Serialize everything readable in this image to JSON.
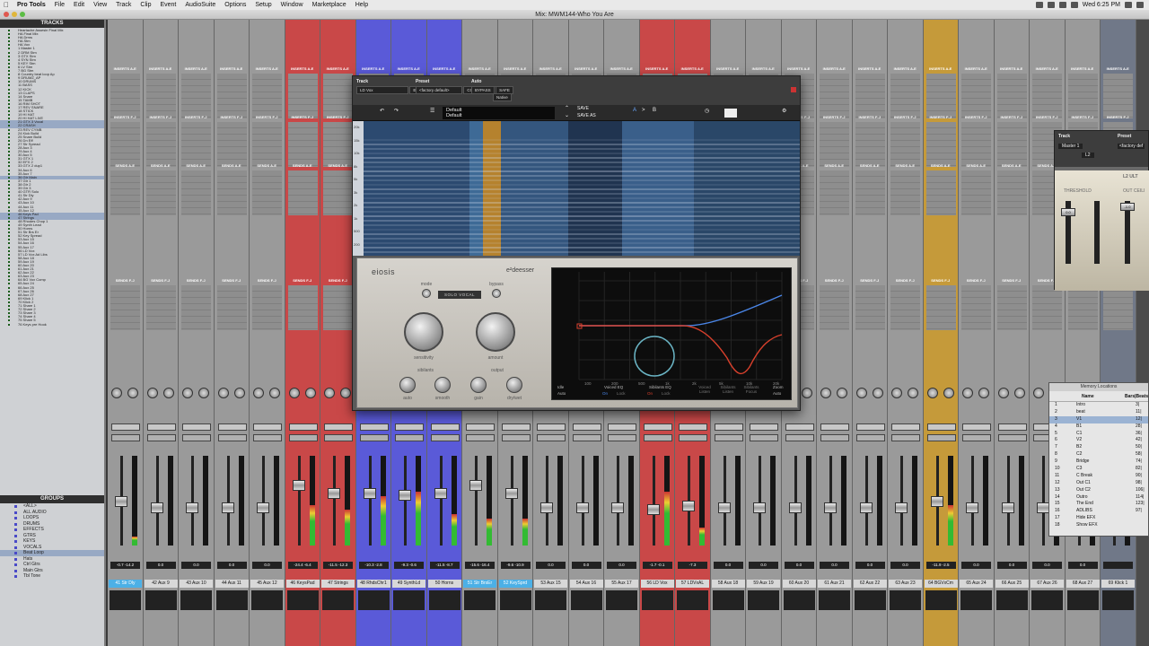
{
  "menubar": {
    "app": "Pro Tools",
    "menus": [
      "File",
      "Edit",
      "View",
      "Track",
      "Clip",
      "Event",
      "AudioSuite",
      "Options",
      "Setup",
      "Window",
      "Marketplace",
      "Help"
    ],
    "clock": "Wed 6:25 PM"
  },
  "window": {
    "title": "Mix: MWM144-Who You Are"
  },
  "tracks_panel": {
    "title": "TRACKS",
    "items": [
      "Heartache Assesin Final Mix",
      "HA Final Mix",
      "HA Drms",
      "HA Stm",
      "HA Vox",
      "1 Master 1",
      "2 DRM Stm",
      "3 GTX Stm",
      "4 SYN Stm",
      "5 KEY Stm",
      "6 LV Stm",
      "7 BG Stm",
      "8 Country beat loop Ap",
      "9 DRUMZ_AP",
      "10 DRUMS",
      "11 BASS",
      "12 KICK",
      "13 CLAPS",
      "14 Snare",
      "15 TAMB",
      "16 RIM SHOT",
      "17 REV SNARE",
      "18 STICK",
      "19 HI HAT",
      "20 HI HAT LIVE",
      "21 GTX 3 Vocal",
      "22 CRASH",
      "23 REV CYMB",
      "24 Kick Build",
      "25 Snare Build",
      "26 Dn Eff",
      "27 Str Spread",
      "28 Aux 3",
      "29 Aux 4",
      "30 Aux 5",
      "31 GTX 1",
      "32 EFX 2",
      "33 GTX 2 dup1",
      "34 Aux 6",
      "35 Aux 7",
      "36 Gtr Main",
      "37 Gtr 1",
      "38 Gtr 2",
      "39 Gtr 3",
      "40 GTR Solo",
      "41 Str Dly",
      "42 Aux 9",
      "43 Aux 10",
      "44 Aux 11",
      "45 Aux 12",
      "46 Keys Pad",
      "47 Strings",
      "48 Rhodes Chop 1",
      "49 Synth Lead",
      "50 Horns",
      "51 Str Brs Er",
      "52 Key Spread",
      "53 Aux 15",
      "54 Aux 16",
      "55 Aux 17",
      "56 LD Vox",
      "57 LD Vox Ad Libs",
      "58 Aux 18",
      "59 Aux 19",
      "60 Aux 20",
      "61 Aux 21",
      "62 Aux 22",
      "63 Aux 23",
      "64 BG Vox Comp",
      "65 Aux 24",
      "66 Aux 25",
      "67 Aux 26",
      "68 Aux 27",
      "69 Klick 1",
      "70 Klick 2",
      "71 Share 1",
      "72 Share 2",
      "73 Share 3",
      "74 Share 4",
      "75 Share 5",
      "76 Keys pre Hook"
    ]
  },
  "groups_panel": {
    "title": "GROUPS",
    "items": [
      "<ALL>",
      "ALL AUDIO",
      "LOOPS",
      "DRUMS",
      "EFFECTS",
      "GTRS",
      "KEYS",
      "VOCALS",
      "Beat Loop",
      "Hats",
      "Ctrl Gtrs",
      "Main Gtrs",
      "Tbl Tone"
    ]
  },
  "mixer": {
    "inserts_label": "INSERTS A-E",
    "inserts_label2": "INSERTS F-J",
    "sends_label": "SENDS A-E",
    "sends_label2": "SENDS F-J",
    "strips": [
      {
        "name": "41 Str Dly",
        "color": "#9a9a9a",
        "vol": "-0.7  -14.2",
        "fader": 0.5,
        "meter": 0.1,
        "hl": true
      },
      {
        "name": "42 Aux 9",
        "color": "#9a9a9a",
        "vol": "0.0",
        "fader": 0.42,
        "meter": 0.0
      },
      {
        "name": "43 Aux 10",
        "color": "#9a9a9a",
        "vol": "0.0",
        "fader": 0.42,
        "meter": 0.0
      },
      {
        "name": "44 Aux 11",
        "color": "#9a9a9a",
        "vol": "0.0",
        "fader": 0.42,
        "meter": 0.0
      },
      {
        "name": "45 Aux 12",
        "color": "#9a9a9a",
        "vol": "0.0",
        "fader": 0.42,
        "meter": 0.0
      },
      {
        "name": "46 KeysPad",
        "color": "#c94848",
        "vol": "-24.4  -6.4",
        "fader": 0.7,
        "meter": 0.45
      },
      {
        "name": "47 Strings",
        "color": "#c94848",
        "vol": "-11.5  -12.3",
        "fader": 0.6,
        "meter": 0.4
      },
      {
        "name": "48 RhdsChr1",
        "color": "#5a5ad8",
        "vol": "-10.3  -2.8",
        "fader": 0.6,
        "meter": 0.55
      },
      {
        "name": "49 SynthLd",
        "color": "#5a5ad8",
        "vol": "-9.3  -0.6",
        "fader": 0.58,
        "meter": 0.6
      },
      {
        "name": "50 Horns",
        "color": "#5a5ad8",
        "vol": "-11.5  -8.7",
        "fader": 0.6,
        "meter": 0.35
      },
      {
        "name": "51 Str BrsEr",
        "color": "#9a9a9a",
        "vol": "-15.6  -16.4",
        "fader": 0.7,
        "meter": 0.3,
        "hl": true
      },
      {
        "name": "52 KeySprd",
        "color": "#9a9a9a",
        "vol": "-9.6  -10.9",
        "fader": 0.6,
        "meter": 0.3,
        "hl": true
      },
      {
        "name": "53 Aux 15",
        "color": "#9a9a9a",
        "vol": "0.0",
        "fader": 0.42,
        "meter": 0.0
      },
      {
        "name": "54 Aux 16",
        "color": "#9a9a9a",
        "vol": "0.0",
        "fader": 0.42,
        "meter": 0.0
      },
      {
        "name": "55 Aux 17",
        "color": "#9a9a9a",
        "vol": "0.0",
        "fader": 0.42,
        "meter": 0.0
      },
      {
        "name": "56 LD Vox",
        "color": "#c94848",
        "vol": "-1.7  -0.1",
        "fader": 0.4,
        "meter": 0.6
      },
      {
        "name": "57 LDVxAL",
        "color": "#c94848",
        "vol": "-7.3",
        "fader": 0.45,
        "meter": 0.2
      },
      {
        "name": "58 Aux 18",
        "color": "#9a9a9a",
        "vol": "0.0",
        "fader": 0.42,
        "meter": 0.0
      },
      {
        "name": "59 Aux 19",
        "color": "#9a9a9a",
        "vol": "0.0",
        "fader": 0.42,
        "meter": 0.0
      },
      {
        "name": "60 Aux 20",
        "color": "#9a9a9a",
        "vol": "0.0",
        "fader": 0.42,
        "meter": 0.0
      },
      {
        "name": "61 Aux 21",
        "color": "#9a9a9a",
        "vol": "0.0",
        "fader": 0.42,
        "meter": 0.0
      },
      {
        "name": "62 Aux 22",
        "color": "#9a9a9a",
        "vol": "0.0",
        "fader": 0.42,
        "meter": 0.0
      },
      {
        "name": "63 Aux 23",
        "color": "#9a9a9a",
        "vol": "0.0",
        "fader": 0.42,
        "meter": 0.0
      },
      {
        "name": "64 BGVxCm",
        "color": "#c59a3a",
        "vol": "-11.9  -2.5",
        "fader": 0.5,
        "meter": 0.45
      },
      {
        "name": "65 Aux 24",
        "color": "#9a9a9a",
        "vol": "0.0",
        "fader": 0.42,
        "meter": 0.0
      },
      {
        "name": "66 Aux 25",
        "color": "#9a9a9a",
        "vol": "0.0",
        "fader": 0.42,
        "meter": 0.0
      },
      {
        "name": "67 Aux 26",
        "color": "#9a9a9a",
        "vol": "0.0",
        "fader": 0.42,
        "meter": 0.0
      },
      {
        "name": "68 Aux 27",
        "color": "#9a9a9a",
        "vol": "0.0",
        "fader": 0.42,
        "meter": 0.0
      },
      {
        "name": "69 Klick 1",
        "color": "#707888",
        "vol": "",
        "fader": 0.42,
        "meter": 0.0
      }
    ]
  },
  "plugin": {
    "track_label": "Track",
    "preset_label": "Preset",
    "auto_label": "Auto",
    "track_name": "LD Vox",
    "insert_name": "Eiosis E2Deesser",
    "preset_name": "<factory default>",
    "compare": "COMPARE",
    "bypass": "BYPASS",
    "safe": "SAFE",
    "native": "Native",
    "preset_slot_top": "Default",
    "preset_slot": "Default",
    "save": "SAVE",
    "save_as": "SAVE AS",
    "ab_a": "A",
    "ab_b": "B",
    "brand": "eiosis",
    "product": "e²deesser",
    "mode": "mode",
    "bypass_small": "bypass",
    "solo_vocal": "SOLO VOCAL",
    "sensitivity": "sensitivity",
    "amount": "amount",
    "sibilants": "sibilants",
    "output": "output",
    "auto": "auto",
    "smooth": "smooth",
    "gain": "gain",
    "drywet": "dry/wet",
    "freq_ticks": [
      "100",
      "200",
      "500",
      "1k",
      "2k",
      "5k",
      "10k",
      "20k"
    ],
    "foot": {
      "idle": "Idle",
      "auto": "Auto",
      "voiced_eq": "Voiced EQ",
      "sibilants_eq": "Sibilants EQ",
      "voiced_listen": "Voiced Listen",
      "sibilants_listen": "Sibilants Listen",
      "sibilants_focus": "Sibilants Focus",
      "zoom": "Zoom",
      "zoom_auto": "Auto",
      "on": "On",
      "lock": "Lock"
    },
    "spec_axis": [
      "20k",
      "15k",
      "10k",
      "8k",
      "5k",
      "3k",
      "2k",
      "1k",
      "500",
      "200"
    ]
  },
  "l2": {
    "track_label": "Track",
    "preset_label": "Preset",
    "track": "Master 1",
    "insert": "L2",
    "preset": "<factory def",
    "threshold": "THRESHOLD",
    "out_ceiling": "OUT CEILI",
    "brand": "L2 ULT",
    "thr_val": "0.0",
    "ceil_val": "-1.0"
  },
  "memory": {
    "title": "Memory Locations",
    "col_name": "Name",
    "col_bars": "Bars|Beats",
    "rows": [
      {
        "n": "1",
        "name": "Intro",
        "bars": "3|"
      },
      {
        "n": "2",
        "name": "beat",
        "bars": "11|"
      },
      {
        "n": "3",
        "name": "V1",
        "bars": "12|"
      },
      {
        "n": "4",
        "name": "B1",
        "bars": "28|"
      },
      {
        "n": "5",
        "name": "C1",
        "bars": "36|"
      },
      {
        "n": "6",
        "name": "V2",
        "bars": "42|"
      },
      {
        "n": "7",
        "name": "B2",
        "bars": "50|"
      },
      {
        "n": "8",
        "name": "C2",
        "bars": "58|"
      },
      {
        "n": "9",
        "name": "Bridge",
        "bars": "74|"
      },
      {
        "n": "10",
        "name": "C3",
        "bars": "82|"
      },
      {
        "n": "11",
        "name": "C Break",
        "bars": "90|"
      },
      {
        "n": "12",
        "name": "Out C1",
        "bars": "98|"
      },
      {
        "n": "13",
        "name": "Out C2",
        "bars": "106|"
      },
      {
        "n": "14",
        "name": "Outro",
        "bars": "114|"
      },
      {
        "n": "15",
        "name": "The End",
        "bars": "123|"
      },
      {
        "n": "16",
        "name": "ADLIBS",
        "bars": "97|"
      },
      {
        "n": "17",
        "name": "Hide EFX",
        "bars": ""
      },
      {
        "n": "18",
        "name": "Show EFX",
        "bars": ""
      }
    ]
  },
  "colors": {
    "accent": "#4cb0e6",
    "red": "#c94848",
    "blue": "#5a5ad8",
    "gold": "#c59a3a"
  }
}
